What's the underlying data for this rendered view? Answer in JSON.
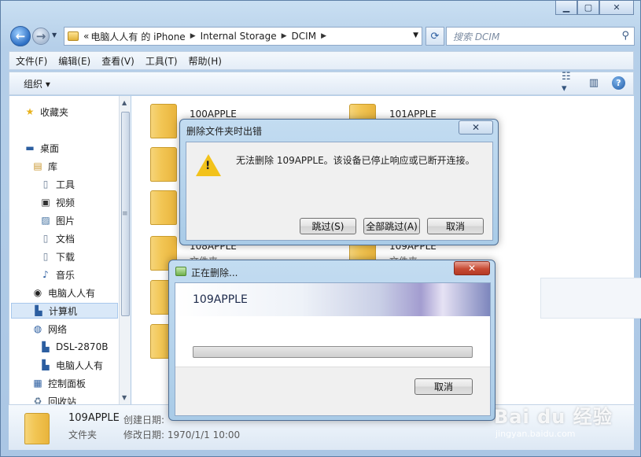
{
  "window": {
    "address": {
      "prefix": "«",
      "crumbs": [
        "电脑人人有",
        "的 iPhone",
        "Internal Storage",
        "DCIM"
      ],
      "dropdown_icon": "chevron-down-icon"
    },
    "search_placeholder": "搜索 DCIM",
    "menu": [
      "文件(F)",
      "编辑(E)",
      "查看(V)",
      "工具(T)",
      "帮助(H)"
    ],
    "toolbar": {
      "organize": "组织 ▾"
    },
    "sidebar": {
      "items": [
        {
          "label": "收藏夹",
          "icon": "star-icon"
        },
        {
          "label": "桌面",
          "icon": "desktop-icon"
        },
        {
          "label": "库",
          "icon": "library-icon"
        },
        {
          "label": "工具",
          "icon": "document-icon"
        },
        {
          "label": "视频",
          "icon": "video-icon"
        },
        {
          "label": "图片",
          "icon": "picture-icon"
        },
        {
          "label": "文档",
          "icon": "document-icon"
        },
        {
          "label": "下载",
          "icon": "document-icon"
        },
        {
          "label": "音乐",
          "icon": "music-icon"
        },
        {
          "label": "电脑人人有",
          "icon": "user-icon"
        },
        {
          "label": "计算机",
          "icon": "computer-icon"
        },
        {
          "label": "网络",
          "icon": "network-icon"
        },
        {
          "label": "DSL-2870B",
          "icon": "computer-icon"
        },
        {
          "label": "电脑人人有",
          "icon": "computer-icon"
        },
        {
          "label": "控制面板",
          "icon": "control-panel-icon"
        },
        {
          "label": "回收站",
          "icon": "recycle-bin-icon"
        }
      ]
    },
    "folders": [
      {
        "name": "100APPLE",
        "type": ""
      },
      {
        "name": "101APPLE",
        "type": ""
      },
      {
        "name": "108APPLE",
        "type": "文件夹"
      },
      {
        "name": "109APPLE",
        "type": "文件夹"
      }
    ],
    "details": {
      "name": "109APPLE",
      "type": "文件夹",
      "created_label": "创建日期:",
      "modified_label": "修改日期: 1970/1/1 10:00"
    }
  },
  "error_dialog": {
    "title": "删除文件夹时出错",
    "message": "无法删除 109APPLE。该设备已停止响应或已断开连接。",
    "buttons": {
      "skip": "跳过(S)",
      "skip_all": "全部跳过(A)",
      "cancel": "取消"
    }
  },
  "progress_dialog": {
    "title": "正在删除...",
    "item": "109APPLE",
    "progress": 0,
    "cancel": "取消"
  },
  "watermark": {
    "brand": "Bai du 经验",
    "url": "jingyan.baidu.com"
  }
}
